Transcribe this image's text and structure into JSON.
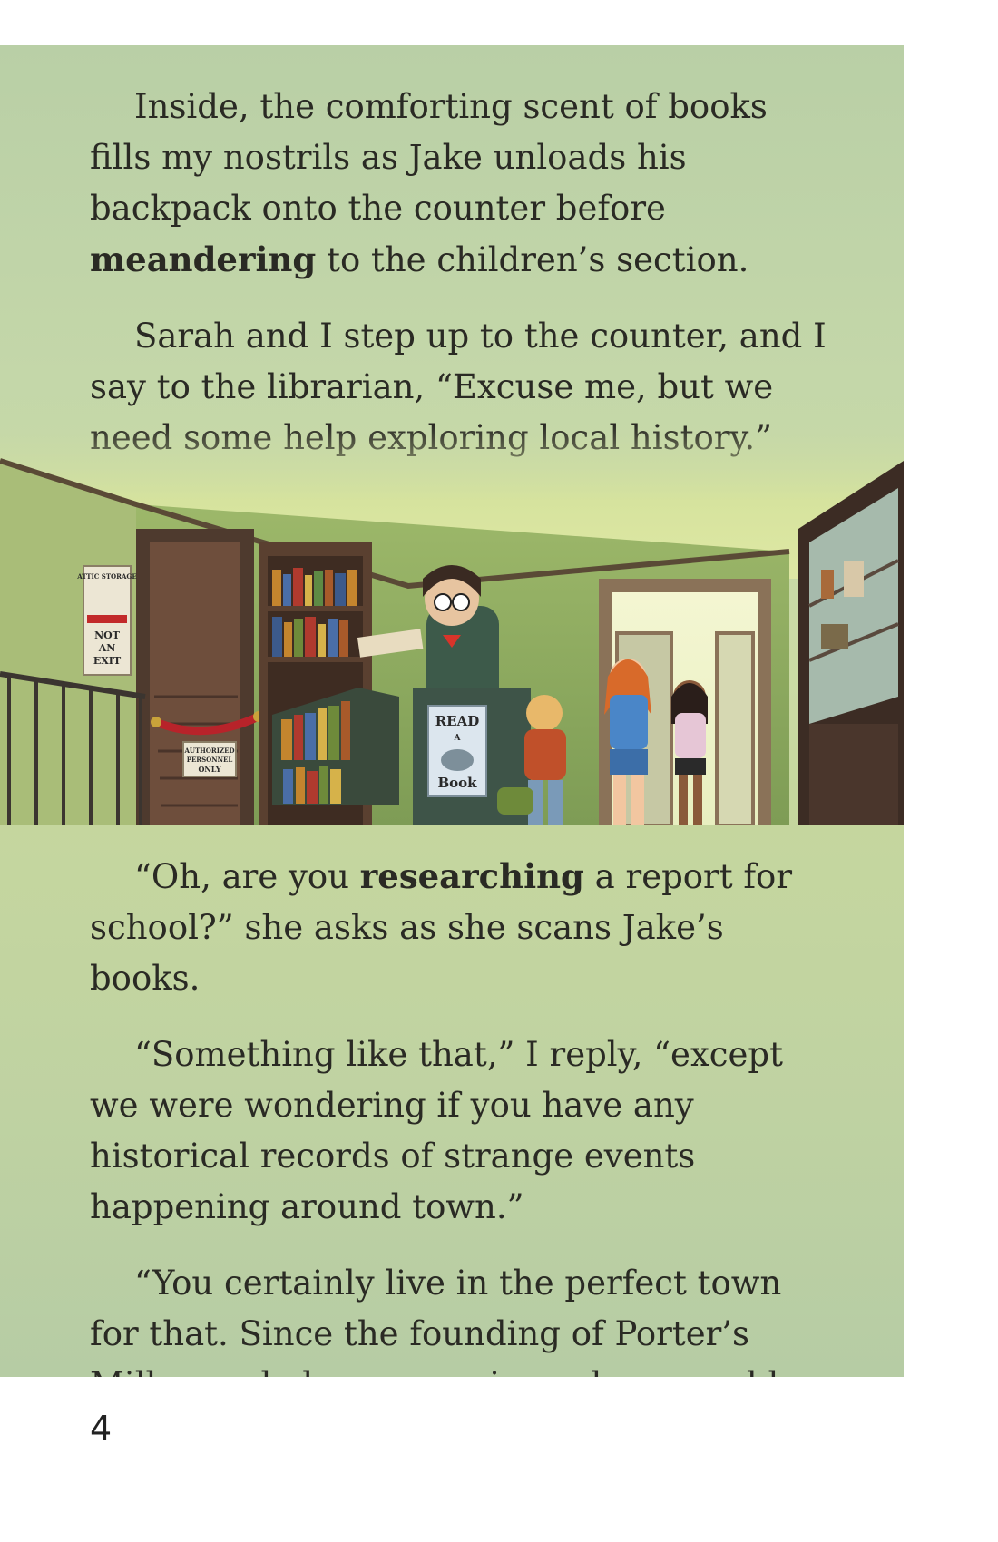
{
  "page": {
    "number": "4"
  },
  "top_paragraphs": [
    {
      "pre": "Inside, the comforting scent of books fills my nostrils as Jake unloads his backpack onto the counter before ",
      "bold": "meandering",
      "post": " to the children’s section."
    },
    {
      "pre": "Sarah and I step up to the counter, and I say to the librarian, “Excuse me, but we need some help exploring local history.”",
      "bold": "",
      "post": ""
    }
  ],
  "bottom_paragraphs": [
    {
      "pre": "“Oh, are you ",
      "bold": "researching",
      "post": " a report for school?” she asks as she scans Jake’s books."
    },
    {
      "pre": "“Something like that,” I reply, “except we were wondering if you have any historical records of strange events happening around town.”",
      "bold": "",
      "post": ""
    },
    {
      "pre": "“You certainly live in the perfect town for that. Since the founding of Porter’s Mill, people have experienced many odd occurrences.”",
      "bold": "",
      "post": ""
    }
  ],
  "illustration": {
    "signs": {
      "attic_sign_top": "ATTIC STORAGE",
      "attic_sign_bottom": [
        "NOT",
        "AN",
        "EXIT"
      ],
      "rope_sign": [
        "AUTHORIZED",
        "PERSONNEL",
        "ONLY"
      ],
      "desk_poster": [
        "READ",
        "A",
        "Book"
      ]
    }
  },
  "colors": {
    "panel_top": "#b9cfa6",
    "panel_bottom": "#b6cca4",
    "text": "#2a2a24"
  }
}
